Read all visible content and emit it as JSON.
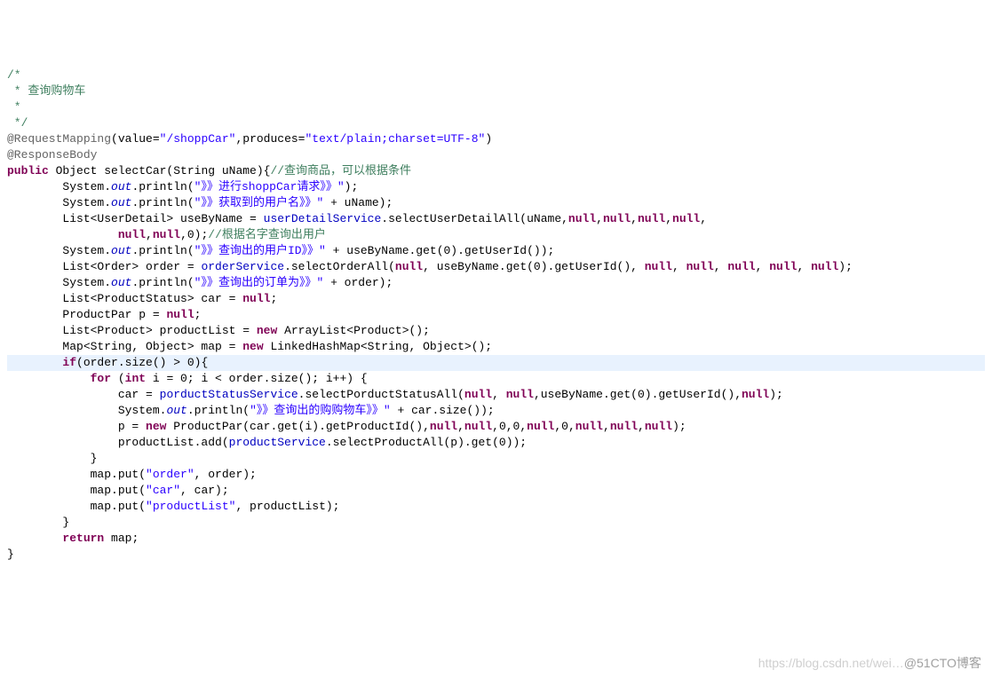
{
  "code": {
    "c01": "/*",
    "c02": " * 查询购物车",
    "c03": " *",
    "c04": " */",
    "ann1_a": "@RequestMapping",
    "ann1_b": "(value=",
    "ann1_c": "\"/shoppCar\"",
    "ann1_d": ",produces=",
    "ann1_e": "\"text/plain;charset=UTF-8\"",
    "ann1_f": ")",
    "ann2": "@ResponseBody",
    "sig_a": "public",
    "sig_b": " Object selectCar(String uName){",
    "sig_c": "//查询商品，可以根据条件",
    "l1_a": "        System.",
    "l1_b": "out",
    "l1_c": ".println(",
    "l1_d": "\"》》进行shoppCar请求》》\"",
    "l1_e": ");",
    "l2_a": "        System.",
    "l2_d": "\"》》获取到的用户名》》\"",
    "l2_e": " + uName);",
    "l3_a": "        List<UserDetail> useByName = ",
    "l3_b": "userDetailService",
    "l3_c": ".selectUserDetailAll(uName,",
    "l3_null": "null",
    "l3_d": ",",
    "l3_e": ",",
    "l3_f": ",",
    "l3_g": ",",
    "l4_a": "                ",
    "l4_b": "null",
    "l4_c": ",",
    "l4_d": ",0);",
    "l4_e": "//根据名字查询出用户",
    "l5_a": "        System.",
    "l5_d": "\"》》查询出的用户ID》》\"",
    "l5_e": " + useByName.get(0).getUserId());",
    "l6_a": "        List<Order> order = ",
    "l6_b": "orderService",
    "l6_c": ".selectOrderAll(",
    "l6_d": ", useByName.get(0).getUserId(), ",
    "l6_e": ", ",
    "l6_f": ");",
    "l7_a": "        System.",
    "l7_d": "\"》》查询出的订单为》》\"",
    "l7_e": " + order);",
    "l8_a": "        List<ProductStatus> car = ",
    "l8_b": "null",
    "l8_c": ";",
    "l9_a": "        ProductPar p = ",
    "l10_a": "        List<Product> productList = ",
    "l10_b": "new",
    "l10_c": " ArrayList<Product>();",
    "l11_a": "        Map<String, Object> map = ",
    "l11_c": " LinkedHashMap<String, Object>();",
    "if_a": "        ",
    "if_b": "if",
    "if_c": "(order.size() > 0){",
    "for_a": "            ",
    "for_b": "for",
    "for_c": " (",
    "for_d": "int",
    "for_e": " i = 0; i < order.size(); i++) {",
    "f1_a": "                car = ",
    "f1_b": "porductStatusService",
    "f1_c": ".selectPorductStatusAll(",
    "f1_d": ", ",
    "f1_e": ",useByName.get(0).getUserId(),",
    "f1_f": ");",
    "f2_a": "                System.",
    "f2_d": "\"》》查询出的购购物车》》\"",
    "f2_e": " + car.size());",
    "f3_a": "                p = ",
    "f3_b": "new",
    "f3_c": " ProductPar(car.get(i).getProductId(),",
    "f3_d": ",",
    "f3_e": ",0,0,",
    "f3_f": ",0,",
    "f3_g": ");",
    "f4_a": "                productList.add(",
    "f4_b": "productService",
    "f4_c": ".selectProductAll(p).get(0));",
    "brace1": "            }",
    "m1_a": "            map.put(",
    "m1_b": "\"order\"",
    "m1_c": ", order);",
    "m2_b": "\"car\"",
    "m2_c": ", car);",
    "m3_b": "\"productList\"",
    "m3_c": ", productList);",
    "brace2": "        }",
    "ret_a": "        ",
    "ret_b": "return",
    "ret_c": " map;",
    "brace3": "}"
  },
  "watermark": {
    "light": "https://blog.csdn.net/wei…",
    "strong": "@51CTO博客"
  }
}
